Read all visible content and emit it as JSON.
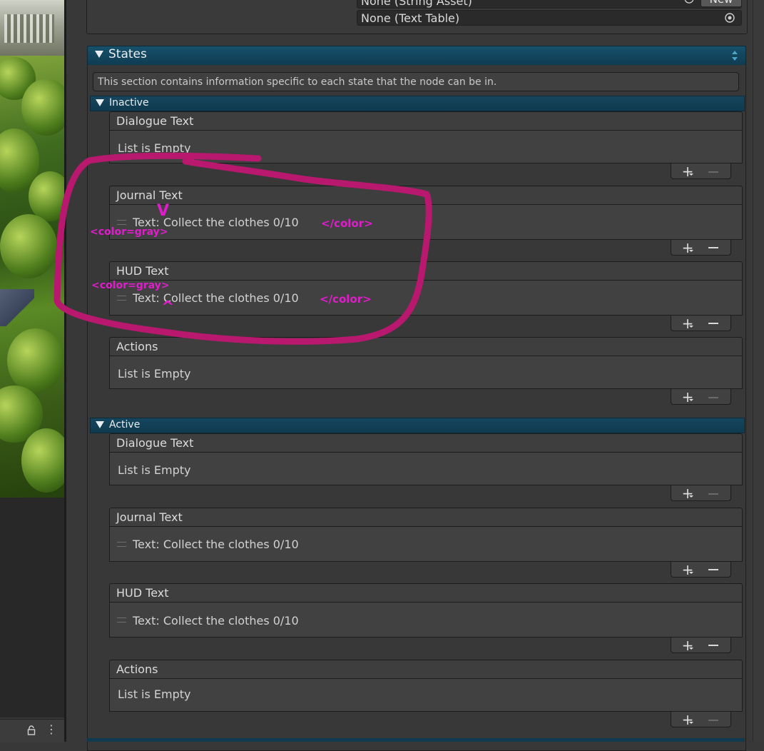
{
  "top_fields": {
    "string_asset": "None (String Asset)",
    "new_button": "New",
    "text_table": "None (Text Table)"
  },
  "states": {
    "title": "States",
    "info": "This section contains information specific to each state that the node can be in.",
    "inactive": {
      "title": "Inactive",
      "dialogue_label": "Dialogue Text",
      "dialogue_empty": "List is Empty",
      "journal_label": "Journal Text",
      "journal_item": "Text: Collect the clothes 0/10",
      "hud_label": "HUD Text",
      "hud_item": "Text: Collect the clothes 0/10",
      "actions_label": "Actions",
      "actions_empty": "List is Empty"
    },
    "active": {
      "title": "Active",
      "dialogue_label": "Dialogue Text",
      "dialogue_empty": "List is Empty",
      "journal_label": "Journal Text",
      "journal_item": "Text: Collect the clothes 0/10",
      "hud_label": "HUD Text",
      "hud_item": "Text: Collect the clothes 0/10",
      "actions_label": "Actions",
      "actions_empty": "List is Empty"
    }
  },
  "annotations": {
    "open_tag_journal": "<color=gray>",
    "close_tag_journal": "</color>",
    "open_tag_hud": "<color=gray>",
    "close_tag_hud": "</color>",
    "arrow_down": "V",
    "arrow_up": "^",
    "color": "#e01ccc",
    "circle_color": "#b8186e"
  },
  "icons": {
    "lock": "lock-icon",
    "more": "kebab-menu-icon",
    "picker": "object-picker-icon",
    "foldout": "triangle-down-icon",
    "updown": "up-down-arrows-icon",
    "add": "plus-icon",
    "remove": "minus-icon"
  }
}
